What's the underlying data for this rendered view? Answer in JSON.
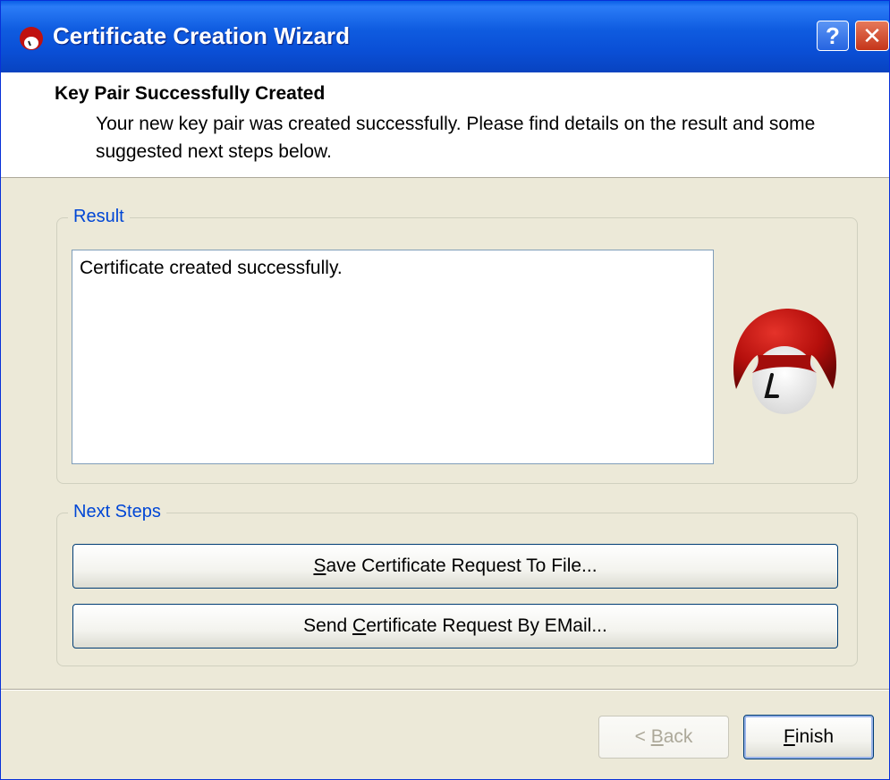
{
  "window": {
    "title": "Certificate Creation Wizard",
    "help_button_label": "?",
    "close_button_label": "✕"
  },
  "header": {
    "title": "Key Pair Successfully Created",
    "description": "Your new key pair was created successfully. Please find details on the result and some suggested next steps below."
  },
  "result": {
    "legend": "Result",
    "text": "Certificate created successfully."
  },
  "next_steps": {
    "legend": "Next Steps",
    "save_button": {
      "mnemonic": "S",
      "rest": "ave Certificate Request To File..."
    },
    "email_button": {
      "prefix": "Send ",
      "mnemonic": "C",
      "rest": "ertificate Request By EMail..."
    }
  },
  "footer": {
    "back_button": {
      "prefix": "< ",
      "mnemonic": "B",
      "rest": "ack",
      "enabled": false
    },
    "finish_button": {
      "mnemonic": "F",
      "rest": "inish"
    }
  },
  "icons": {
    "app": "red-mascot-icon",
    "mascot": "red-mascot-illustration"
  },
  "colors": {
    "titlebar": "#0a5fe6",
    "legend_text": "#0046d5",
    "dialog_bg": "#ece9d8",
    "mascot_red": "#c0110f"
  }
}
